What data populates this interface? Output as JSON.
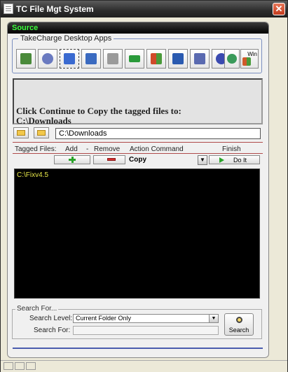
{
  "window": {
    "title": "TC File Mgt System",
    "close_glyph": "✕"
  },
  "source": {
    "label": "Source"
  },
  "apps": {
    "legend": "TakeCharge Desktop Apps",
    "items": [
      {
        "icon": "picture-icon",
        "color": "#4a8a3a"
      },
      {
        "icon": "clock-icon",
        "color": "#6a7ac0"
      },
      {
        "icon": "satellite-icon",
        "color": "#3a6ad0"
      },
      {
        "icon": "documents-icon",
        "color": "#3a6ac0"
      },
      {
        "icon": "calculator-icon",
        "color": "#9a9a9a"
      },
      {
        "icon": "money-icon",
        "color": "#2a9a3a"
      },
      {
        "icon": "windows-flag-icon",
        "color": "#d08a20"
      },
      {
        "icon": "word-icon",
        "color": "#2a5ab0"
      },
      {
        "icon": "windows-stack-icon",
        "color": "#5a6ab0"
      },
      {
        "icon": "info-icon",
        "color": "#3a4ab0"
      },
      {
        "icon": "globe-icon",
        "color": "#3a9a5a"
      },
      {
        "icon": "windows-logo-icon",
        "color": "#d05a2a",
        "text": "Win"
      }
    ]
  },
  "message": {
    "line1": "Click Continue to Copy the tagged files to:",
    "line2": "C:\\Downloads"
  },
  "destination": {
    "path": "C:\\Downloads"
  },
  "headers": {
    "tagged": "Tagged Files:",
    "add": "Add",
    "dash": "-",
    "remove": "Remove",
    "action": "Action Command",
    "finish": "Finish"
  },
  "action": {
    "command": "Copy",
    "doit": "Do It"
  },
  "files": {
    "items": [
      "C:\\Fixv4.5"
    ]
  },
  "search": {
    "legend": "Search For...",
    "level_label": "Search Level:",
    "level_value": "Current Folder Only",
    "for_label": "Search For:",
    "button": "Search"
  },
  "colors": {
    "accent": "#3cff3c",
    "file_text": "#e8e84a",
    "divider": "#b04a4a"
  }
}
